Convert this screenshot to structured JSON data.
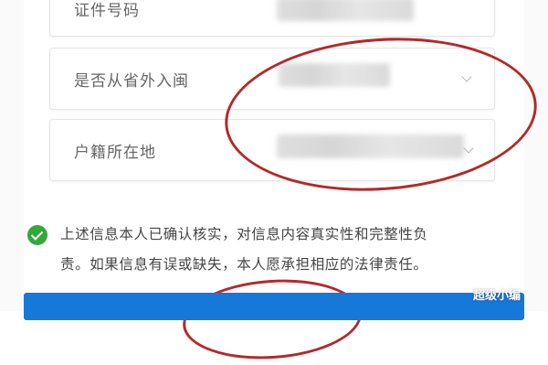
{
  "form": {
    "fields": [
      {
        "label": "证件号码",
        "dropdown": false
      },
      {
        "label": "是否从省外入闽",
        "dropdown": true
      },
      {
        "label": "户籍所在地",
        "dropdown": true
      }
    ]
  },
  "consent": {
    "checked": true,
    "line1": "上述信息本人已确认核实，对信息内容真实性和完整性负",
    "line2": "责。如果信息有误或缺失，本人愿承担相应的法律责任。"
  },
  "watermark": {
    "text": "超级小编"
  },
  "colors": {
    "accent": "#1678d8",
    "annotation": "#b32a2a",
    "check": "#33a83a"
  }
}
